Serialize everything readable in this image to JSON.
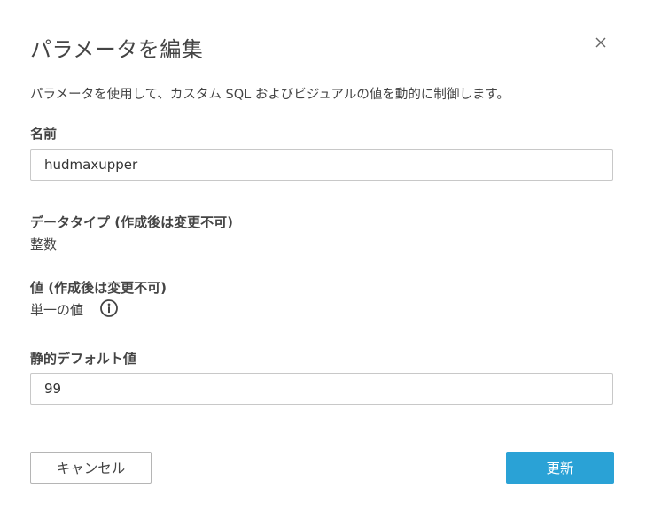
{
  "dialog": {
    "title": "パラメータを編集",
    "close_icon": "close-icon",
    "description": "パラメータを使用して、カスタム SQL およびビジュアルの値を動的に制御します。"
  },
  "name_field": {
    "label": "名前",
    "value": "hudmaxupper"
  },
  "data_type": {
    "label": "データタイプ (作成後は変更不可)",
    "value": "整数"
  },
  "values": {
    "label": "値 (作成後は変更不可)",
    "value": "単一の値",
    "info_icon": "info-icon"
  },
  "default_value": {
    "label": "静的デフォルト値",
    "value": "99"
  },
  "actions": {
    "cancel_label": "キャンセル",
    "update_label": "更新"
  },
  "colors": {
    "primary_button": "#2aa2d6",
    "text": "#444444",
    "border": "#c8c8c8"
  }
}
